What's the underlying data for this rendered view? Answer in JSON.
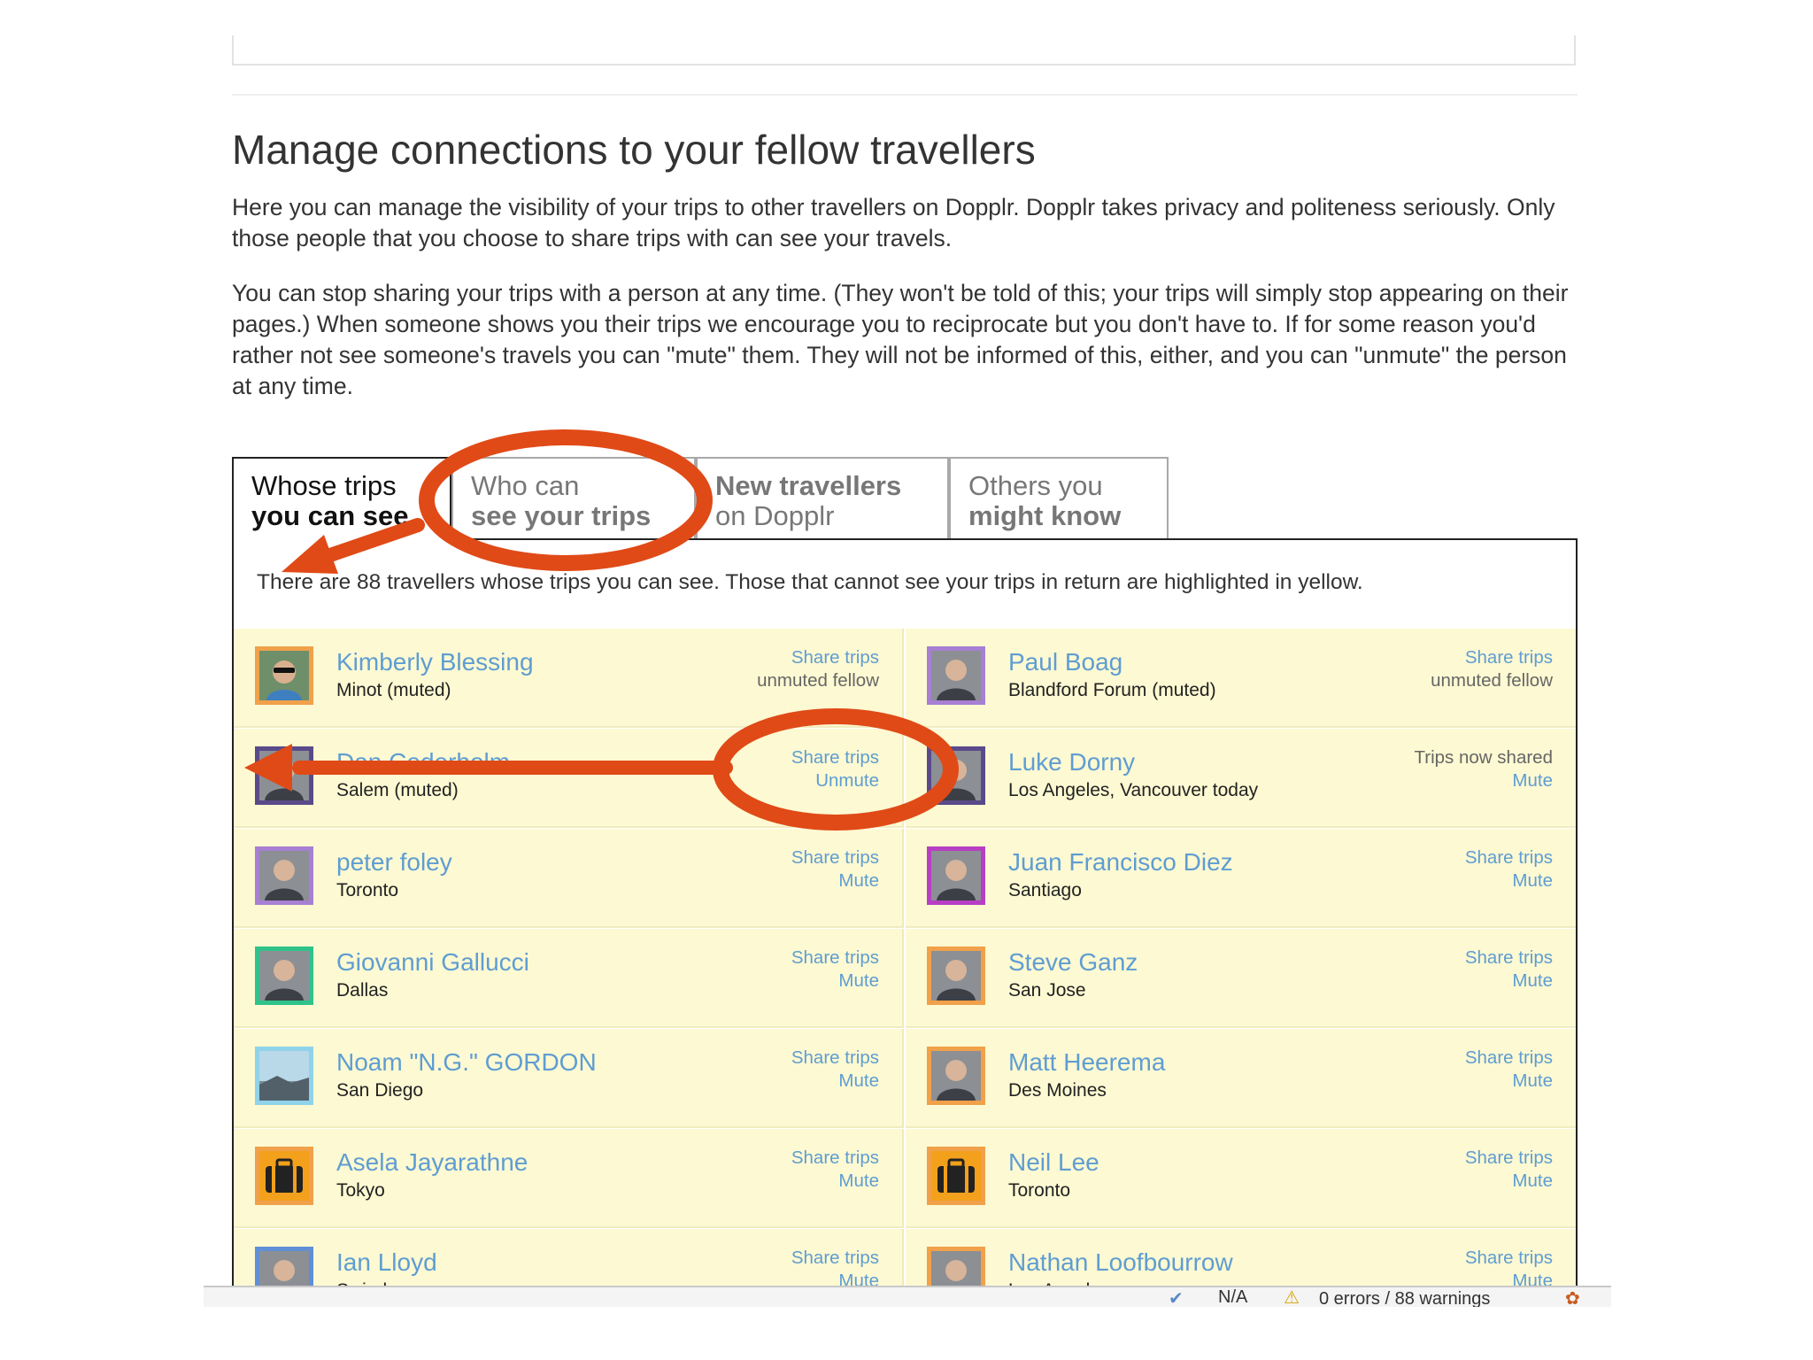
{
  "page": {
    "title": "Manage connections to your fellow travellers",
    "intro_1": "Here you can manage the visibility of your trips to other travellers on Dopplr. Dopplr takes privacy and politeness seriously. Only those people that you choose to share trips with can see your travels.",
    "intro_2": "You can stop sharing your trips with a person at any time. (They won't be told of this; your trips will simply stop appearing on their pages.) When someone shows you their trips we encourage you to reciprocate but you don't have to. If for some reason you'd rather not see someone's travels you can \"mute\" them. They will not be informed of this, either, and you can \"unmute\" the person at any time."
  },
  "tabs": [
    {
      "line1": "Whose trips",
      "line2": "you can see"
    },
    {
      "line1": "Who can",
      "line2": "see your trips"
    },
    {
      "line1": "New travellers",
      "line2": "on Dopplr"
    },
    {
      "line1": "Others you",
      "line2": "might know"
    }
  ],
  "panel": {
    "info": "There are 88 travellers whose trips you can see. Those that cannot see your trips in return are highlighted in yellow."
  },
  "travellers": [
    {
      "name": "Kimberly Blessing",
      "location": "Minot (muted)",
      "action_1": "Share trips",
      "action_2": "unmuted fellow",
      "avatar_icon": "portrait-sunglasses-icon",
      "avatar_border": "#f0a14a"
    },
    {
      "name": "Paul Boag",
      "location": "Blandford Forum (muted)",
      "action_1": "Share trips",
      "action_2": "unmuted fellow",
      "avatar_icon": "portrait-icon",
      "avatar_border": "#a77fd3"
    },
    {
      "name": "Dan Cederholm",
      "location": "Salem (muted)",
      "action_1": "Share trips",
      "action_2": "Unmute",
      "avatar_icon": "portrait-icon",
      "avatar_border": "#5a4a8a"
    },
    {
      "name": "Luke Dorny",
      "location": "Los Angeles, Vancouver today",
      "action_1": "Trips now shared",
      "action_2": "Mute",
      "avatar_icon": "portrait-icon",
      "avatar_border": "#5a4a8a"
    },
    {
      "name": "peter foley",
      "location": "Toronto",
      "action_1": "Share trips",
      "action_2": "Mute",
      "avatar_icon": "portrait-icon",
      "avatar_border": "#a77fd3"
    },
    {
      "name": "Juan Francisco Diez",
      "location": "Santiago",
      "action_1": "Share trips",
      "action_2": "Mute",
      "avatar_icon": "portrait-icon",
      "avatar_border": "#b63fc4"
    },
    {
      "name": "Giovanni Gallucci",
      "location": "Dallas",
      "action_1": "Share trips",
      "action_2": "Mute",
      "avatar_icon": "portrait-icon",
      "avatar_border": "#2fc28a"
    },
    {
      "name": "Steve Ganz",
      "location": "San Jose",
      "action_1": "Share trips",
      "action_2": "Mute",
      "avatar_icon": "portrait-icon",
      "avatar_border": "#f0a14a"
    },
    {
      "name": "Noam \"N.G.\" GORDON",
      "location": "San Diego",
      "action_1": "Share trips",
      "action_2": "Mute",
      "avatar_icon": "landscape-icon",
      "avatar_border": "#8fd3ea"
    },
    {
      "name": "Matt Heerema",
      "location": "Des Moines",
      "action_1": "Share trips",
      "action_2": "Mute",
      "avatar_icon": "portrait-icon",
      "avatar_border": "#f0a14a"
    },
    {
      "name": "Asela Jayarathne",
      "location": "Tokyo",
      "action_1": "Share trips",
      "action_2": "Mute",
      "avatar_icon": "suitcase-icon",
      "avatar_border": "#f0a14a"
    },
    {
      "name": "Neil Lee",
      "location": "Toronto",
      "action_1": "Share trips",
      "action_2": "Mute",
      "avatar_icon": "suitcase-icon",
      "avatar_border": "#f0a14a"
    },
    {
      "name": "Ian Lloyd",
      "location": "Swindon",
      "action_1": "Share trips",
      "action_2": "Mute",
      "avatar_icon": "portrait-icon",
      "avatar_border": "#5f8fd6"
    },
    {
      "name": "Nathan Loofbourrow",
      "location": "Los Angeles",
      "action_1": "Share trips",
      "action_2": "Mute",
      "avatar_icon": "portrait-icon",
      "avatar_border": "#f0a14a"
    }
  ],
  "status_bar": {
    "validation": "N/A",
    "warnings": "0 errors / 88 warnings"
  },
  "colors": {
    "link": "#5f9dd1",
    "highlight": "#fdf9d2",
    "annotation": "#e04a17"
  }
}
